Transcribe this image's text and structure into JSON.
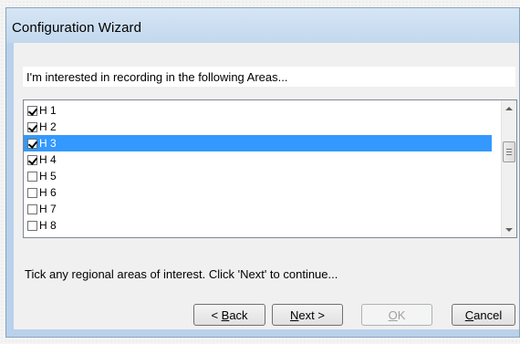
{
  "window": {
    "title": "Configuration Wizard"
  },
  "prompt": "I'm interested in recording in the following Areas...",
  "areas": [
    {
      "label": "H 1",
      "checked": true,
      "selected": false
    },
    {
      "label": "H 2",
      "checked": true,
      "selected": false
    },
    {
      "label": "H 3",
      "checked": true,
      "selected": true
    },
    {
      "label": "H 4",
      "checked": true,
      "selected": false
    },
    {
      "label": "H 5",
      "checked": false,
      "selected": false
    },
    {
      "label": "H 6",
      "checked": false,
      "selected": false
    },
    {
      "label": "H 7",
      "checked": false,
      "selected": false
    },
    {
      "label": "H 8",
      "checked": false,
      "selected": false
    }
  ],
  "hint": "Tick any regional areas of interest.  Click 'Next' to continue...",
  "buttons": {
    "back": {
      "prefix": "< ",
      "mnemonic": "B",
      "rest": "ack"
    },
    "next": {
      "mnemonic": "N",
      "rest": "ext >"
    },
    "ok": {
      "mnemonic": "O",
      "rest": "K"
    },
    "cancel": {
      "mnemonic": "C",
      "rest": "ancel"
    }
  },
  "icons": {
    "scroll_up": "triangle-up-icon",
    "scroll_down": "triangle-down-icon",
    "checkbox_checked": "checkmark-icon"
  }
}
